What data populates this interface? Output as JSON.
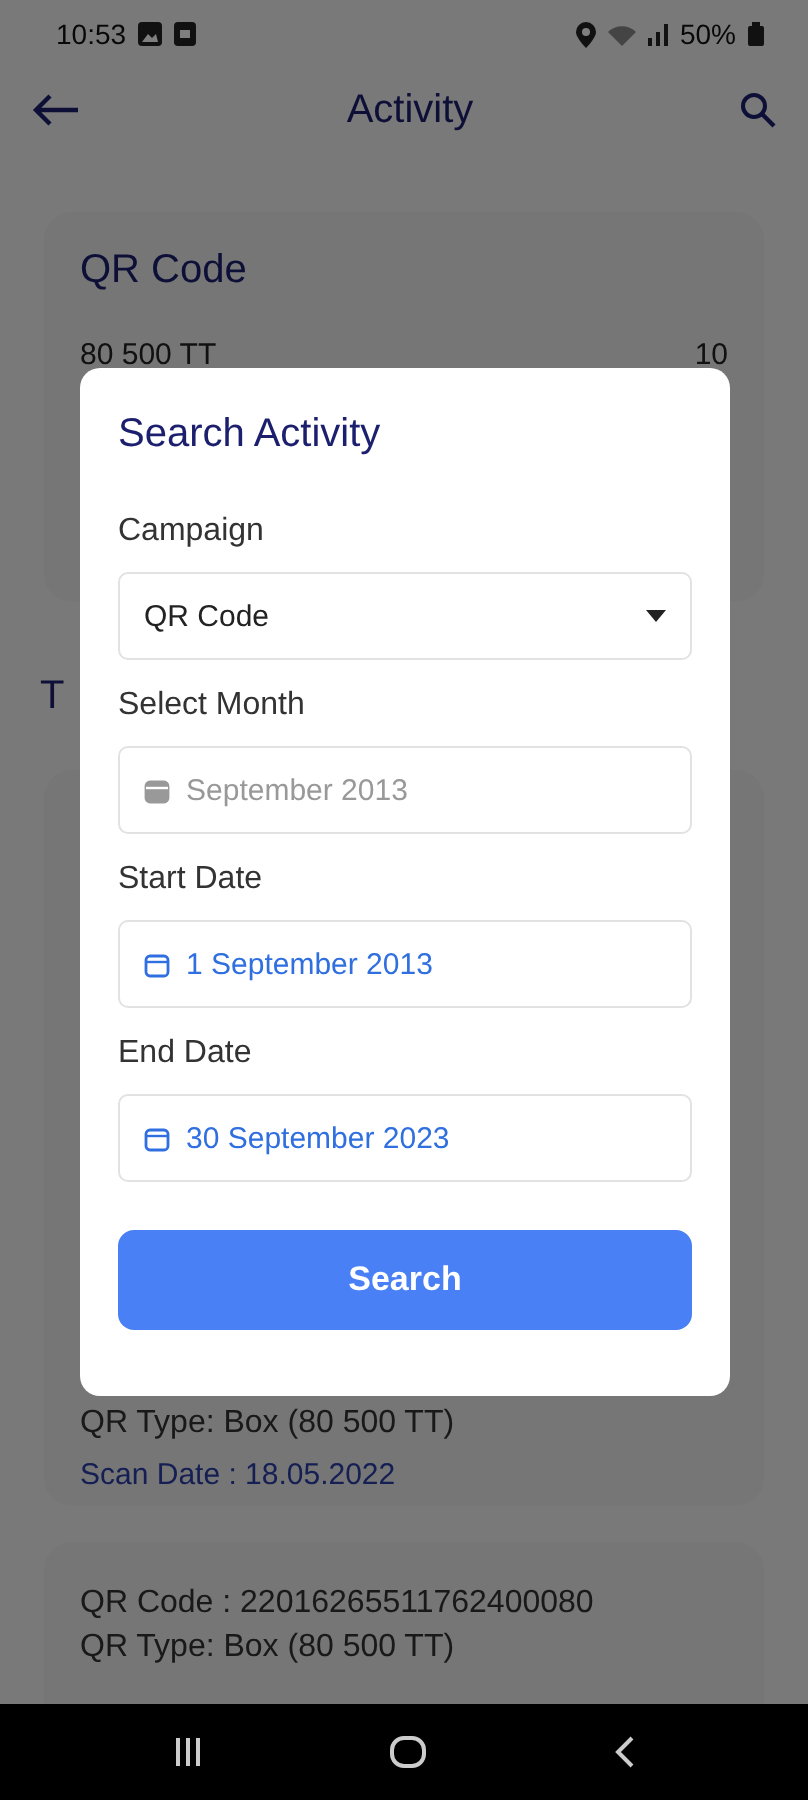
{
  "status_bar": {
    "time": "10:53",
    "battery": "50%"
  },
  "app_bar": {
    "title": "Activity"
  },
  "summary_card": {
    "title": "QR Code",
    "rows": [
      {
        "label": "80 500 TT",
        "value": "10"
      }
    ]
  },
  "section_heading": "T",
  "scan_cards": [
    {
      "lines": [
        {
          "kind": "plain",
          "text": "QR Type: Box (80 500 TT)"
        },
        {
          "kind": "date",
          "text": "Scan Date : 18.05.2022"
        }
      ]
    },
    {
      "lines": [
        {
          "kind": "plain",
          "text": "QR Code : 22016265511762400080"
        },
        {
          "kind": "plain",
          "text": "QR Type: Box (80 500 TT)"
        }
      ]
    }
  ],
  "dialog": {
    "title": "Search Activity",
    "fields": [
      {
        "kind": "select",
        "label": "Campaign",
        "value": "QR Code",
        "disabled": false
      },
      {
        "kind": "date",
        "label": "Select Month",
        "value": "September 2013",
        "disabled": true
      },
      {
        "kind": "date",
        "label": "Start Date",
        "value": "1 September 2013",
        "disabled": false
      },
      {
        "kind": "date",
        "label": "End Date",
        "value": "30 September 2023",
        "disabled": false
      }
    ],
    "button": "Search"
  }
}
